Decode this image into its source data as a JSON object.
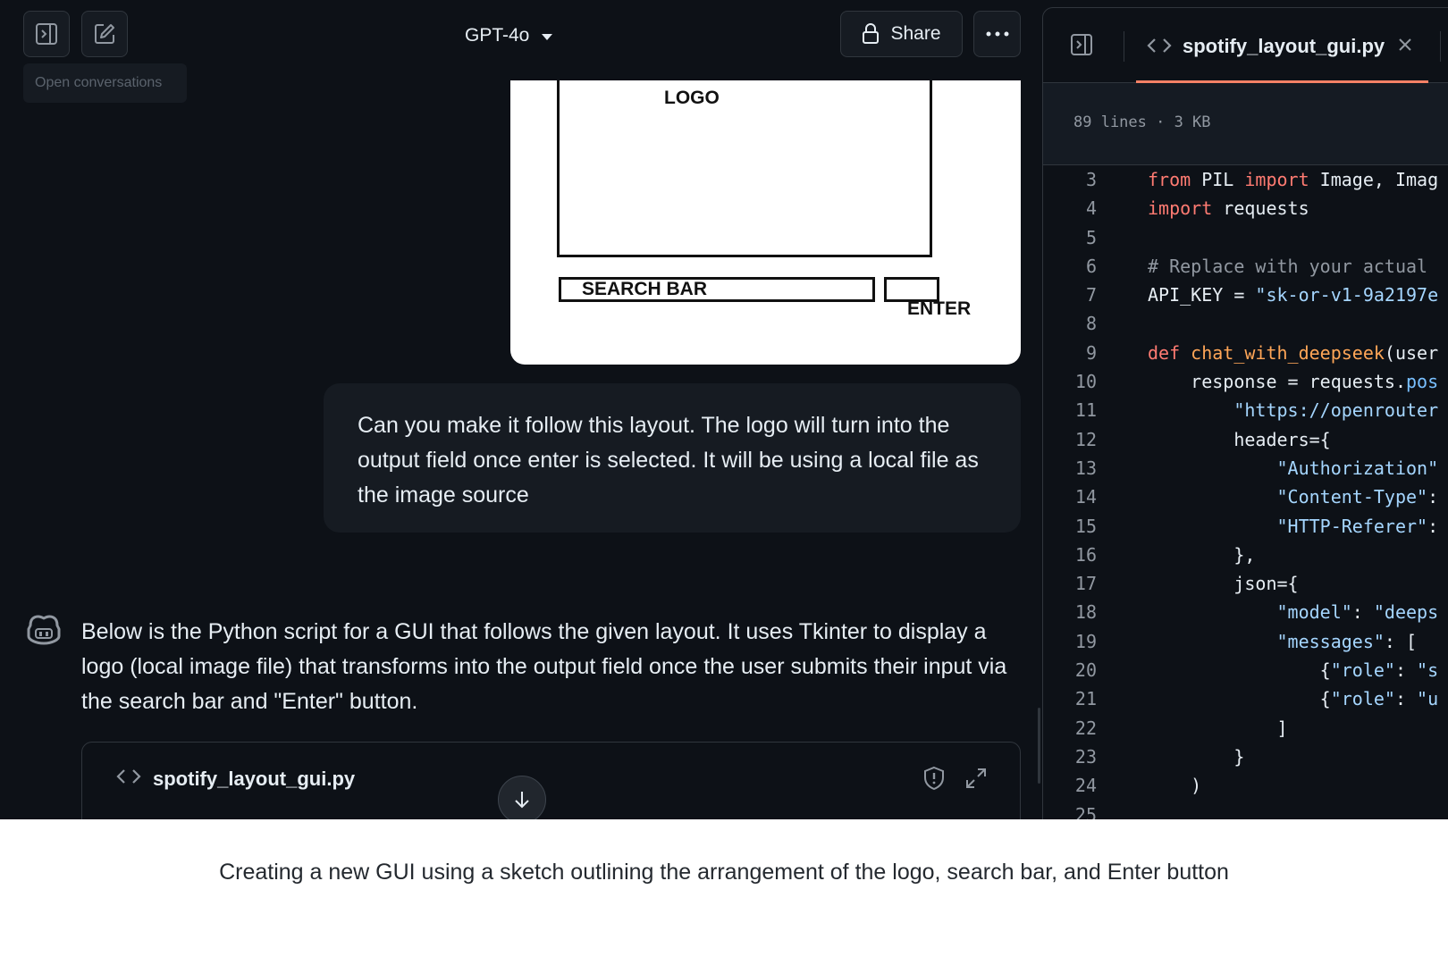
{
  "topbar": {
    "tooltip": "Open conversations",
    "model_name": "GPT-4o",
    "share_label": "Share"
  },
  "sketch": {
    "logo_label": "LOGO",
    "search_label": "SEARCH BAR",
    "enter_label": "ENTER"
  },
  "user_message": "Can you make it follow this layout. The logo will turn into the output field once enter is selected. It will be using a local file as the image source",
  "assistant_message": "Below is the Python script for a GUI that follows the given layout. It uses Tkinter to display a logo (local image file) that transforms into the output field once the user submits their input via the search bar and \"Enter\" button.",
  "code_card": {
    "filename": "spotify_layout_gui.py"
  },
  "code_panel": {
    "tab_title": "spotify_layout_gui.py",
    "file_info": "89 lines · 3 KB",
    "lines": [
      {
        "n": "3",
        "html": "<span class=\"kw\">from</span> PIL <span class=\"kw\">import</span> Image, Imag"
      },
      {
        "n": "4",
        "html": "<span class=\"kw\">import</span> requests"
      },
      {
        "n": "5",
        "html": ""
      },
      {
        "n": "6",
        "html": "<span class=\"cm\"># Replace with your actual</span>"
      },
      {
        "n": "7",
        "html": "API_KEY = <span class=\"str\">\"sk-or-v1-9a2197e</span>"
      },
      {
        "n": "8",
        "html": ""
      },
      {
        "n": "9",
        "html": "<span class=\"kw\">def</span> <span class=\"fn\">chat_with_deepseek</span>(user"
      },
      {
        "n": "10",
        "html": "    response = requests.<span class=\"attr\">pos</span>"
      },
      {
        "n": "11",
        "html": "        <span class=\"str\">\"https://openrouter</span>"
      },
      {
        "n": "12",
        "html": "        headers={"
      },
      {
        "n": "13",
        "html": "            <span class=\"str\">\"Authorization\"</span>"
      },
      {
        "n": "14",
        "html": "            <span class=\"str\">\"Content-Type\"</span>:"
      },
      {
        "n": "15",
        "html": "            <span class=\"str\">\"HTTP-Referer\"</span>:"
      },
      {
        "n": "16",
        "html": "        },"
      },
      {
        "n": "17",
        "html": "        json={"
      },
      {
        "n": "18",
        "html": "            <span class=\"str\">\"model\"</span>: <span class=\"str\">\"deeps</span>"
      },
      {
        "n": "19",
        "html": "            <span class=\"str\">\"messages\"</span>: ["
      },
      {
        "n": "20",
        "html": "                {<span class=\"str\">\"role\"</span>: <span class=\"str\">\"s</span>"
      },
      {
        "n": "21",
        "html": "                {<span class=\"str\">\"role\"</span>: <span class=\"str\">\"u</span>"
      },
      {
        "n": "22",
        "html": "            ]"
      },
      {
        "n": "23",
        "html": "        }"
      },
      {
        "n": "24",
        "html": "    )"
      },
      {
        "n": "25",
        "html": ""
      }
    ]
  },
  "caption": "Creating a new GUI using a sketch outlining the arrangement of the logo, search bar, and Enter button",
  "icons": {
    "sidebar": "sidebar-toggle-icon",
    "new_chat": "new-chat-icon",
    "lock": "lock-icon",
    "more": "more-icon",
    "copilot": "copilot-icon",
    "code": "code-icon",
    "shield": "shield-icon",
    "expand": "expand-icon",
    "arrow_down": "arrow-down-icon",
    "close": "close-icon"
  },
  "colors": {
    "background": "#0d1117",
    "tab_accent": "#f78166",
    "keyword": "#ff7b72",
    "string": "#a5d6ff"
  }
}
